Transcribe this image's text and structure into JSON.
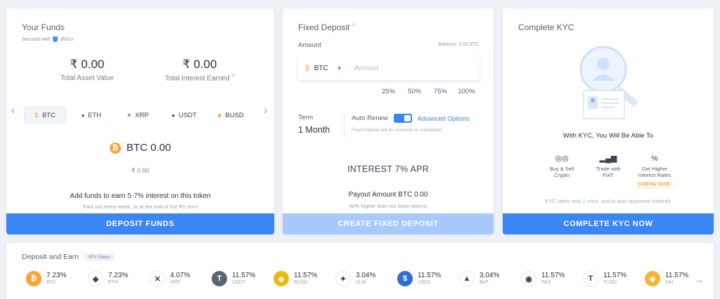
{
  "funds": {
    "title": "Your Funds",
    "secured_with": "Secured with",
    "secured_by": "BitGo",
    "total_asset_value": "₹ 0.00",
    "total_asset_label": "Total Asset Value",
    "total_interest_value": "₹ 0.00",
    "total_interest_label": "Total Interest Earned",
    "interest_info": "®",
    "coins": [
      {
        "symbol": "BTC",
        "icon": "btc-icon",
        "color": "#f7a533",
        "glyph": "₿"
      },
      {
        "symbol": "ETH",
        "icon": "eth-icon",
        "color": "#3c4455",
        "glyph": "♦"
      },
      {
        "symbol": "XRP",
        "icon": "xrp-icon",
        "color": "#3c4455",
        "glyph": "✕"
      },
      {
        "symbol": "USDT",
        "icon": "usdt-icon",
        "color": "#3c4455",
        "glyph": "●"
      },
      {
        "symbol": "BUSD",
        "icon": "busd-icon",
        "color": "#f0b90b",
        "glyph": "◆"
      }
    ],
    "selected_coin_amount": "BTC 0.00",
    "selected_coin_inr": "₹ 0.00",
    "earn_prefix": "Add funds to earn",
    "earn_rate": "5-7%",
    "earn_suffix": "interest on this token",
    "earn_sub": "Paid out every week, or at the end of the FD term",
    "cta": "DEPOSIT FUNDS"
  },
  "fixed_deposit": {
    "title": "Fixed Deposit",
    "title_mark": "®",
    "amount_label": "Amount",
    "balance": "Balance: 0.00 BTC",
    "coin": "BTC",
    "amount_placeholder": "Amount",
    "percents": [
      "25%",
      "50%",
      "75%",
      "100%"
    ],
    "term_label": "Term",
    "term_value": "1 Month",
    "auto_renew_label": "Auto Renew",
    "advanced_options": "Advanced Options",
    "renew_note": "Fixed Deposit will be renewed on completion",
    "interest": "INTEREST 7% APR",
    "payout": "Payout Amount BTC 0.00",
    "payout_sub": "40% higher than our base returns",
    "cta": "CREATE FIXED DEPOSIT"
  },
  "kyc": {
    "title": "Complete KYC",
    "heading": "With KYC, You Will Be Able To",
    "features": [
      {
        "icon": "exchange-icon",
        "glyph": "◎◎",
        "label_1": "Buy & Sell",
        "label_2": "Crypto"
      },
      {
        "icon": "trade-icon",
        "glyph": "▂▄▆",
        "label_1": "Trade with",
        "label_2": "FIAT"
      },
      {
        "icon": "percent-icon",
        "glyph": "%",
        "label_1": "Get Higher",
        "label_2": "Interest Rates",
        "badge": "COMING SOON"
      }
    ],
    "note": "KYC takes only 2 mins, and is auto approved instantly",
    "cta": "COMPLETE KYC NOW"
  },
  "deposit_earn": {
    "title": "Deposit and Earn",
    "pill": "APY Rates",
    "rates": [
      {
        "rate": "7.23%",
        "symbol": "BTC",
        "color": "#f7a533",
        "glyph": "₿",
        "icon": "btc-coin-icon"
      },
      {
        "rate": "7.23%",
        "symbol": "ETH",
        "color": "#ffffff",
        "glyph": "◆",
        "icon": "eth-coin-icon"
      },
      {
        "rate": "4.07%",
        "symbol": "XRP",
        "color": "#ffffff",
        "glyph": "✕",
        "icon": "xrp-coin-icon"
      },
      {
        "rate": "11.57%",
        "symbol": "USDT",
        "color": "#5b6472",
        "glyph": "T",
        "icon": "usdt-coin-icon"
      },
      {
        "rate": "11.57%",
        "symbol": "BUSD",
        "color": "#f0b90b",
        "glyph": "◆",
        "icon": "busd-coin-icon"
      },
      {
        "rate": "3.04%",
        "symbol": "XLM",
        "color": "#ffffff",
        "glyph": "✦",
        "icon": "xlm-coin-icon"
      },
      {
        "rate": "11.57%",
        "symbol": "USDC",
        "color": "#2f6fd1",
        "glyph": "$",
        "icon": "usdc-coin-icon"
      },
      {
        "rate": "3.04%",
        "symbol": "BAT",
        "color": "#ffffff",
        "glyph": "▲",
        "icon": "bat-coin-icon"
      },
      {
        "rate": "11.57%",
        "symbol": "PAX",
        "color": "#ffffff",
        "glyph": "◉",
        "icon": "pax-coin-icon"
      },
      {
        "rate": "11.57%",
        "symbol": "TUSD",
        "color": "#ffffff",
        "glyph": "T",
        "icon": "tusd-coin-icon"
      },
      {
        "rate": "11.57%",
        "symbol": "DAI",
        "color": "#f4b731",
        "glyph": "◈",
        "icon": "dai-coin-icon"
      }
    ]
  }
}
